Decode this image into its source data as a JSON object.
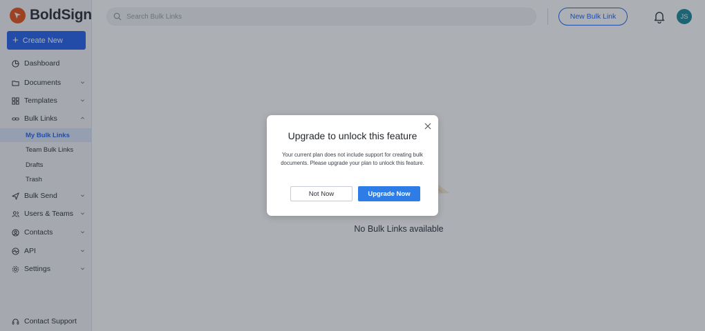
{
  "brand": {
    "name": "BoldSign",
    "logo_color": "#e8541c",
    "accent": "#2563eb"
  },
  "sidebar": {
    "create_label": "Create New",
    "items": [
      {
        "label": "Dashboard",
        "icon": "dashboard-icon",
        "expandable": false
      },
      {
        "label": "Documents",
        "icon": "folder-icon",
        "expandable": true
      },
      {
        "label": "Templates",
        "icon": "grid-icon",
        "expandable": true
      },
      {
        "label": "Bulk Links",
        "icon": "link-icon",
        "expandable": true,
        "expanded": true,
        "children": [
          {
            "label": "My Bulk Links",
            "active": true
          },
          {
            "label": "Team Bulk Links"
          },
          {
            "label": "Drafts"
          },
          {
            "label": "Trash"
          }
        ]
      },
      {
        "label": "Bulk Send",
        "icon": "send-icon",
        "expandable": true
      },
      {
        "label": "Users & Teams",
        "icon": "users-icon",
        "expandable": true
      },
      {
        "label": "Contacts",
        "icon": "contacts-icon",
        "expandable": true
      },
      {
        "label": "API",
        "icon": "api-icon",
        "expandable": true
      },
      {
        "label": "Settings",
        "icon": "gear-icon",
        "expandable": true
      }
    ],
    "support_label": "Contact Support"
  },
  "header": {
    "search_placeholder": "Search Bulk Links",
    "new_bulk_link_label": "New Bulk Link",
    "avatar_initials": "JS",
    "avatar_color": "#1a8a9b"
  },
  "main": {
    "empty_message": "No Bulk Links available"
  },
  "modal": {
    "title": "Upgrade to unlock this feature",
    "body": "Your current plan does not include support for creating bulk documents. Please upgrade your plan to unlock this feature.",
    "secondary_label": "Not Now",
    "primary_label": "Upgrade Now"
  }
}
